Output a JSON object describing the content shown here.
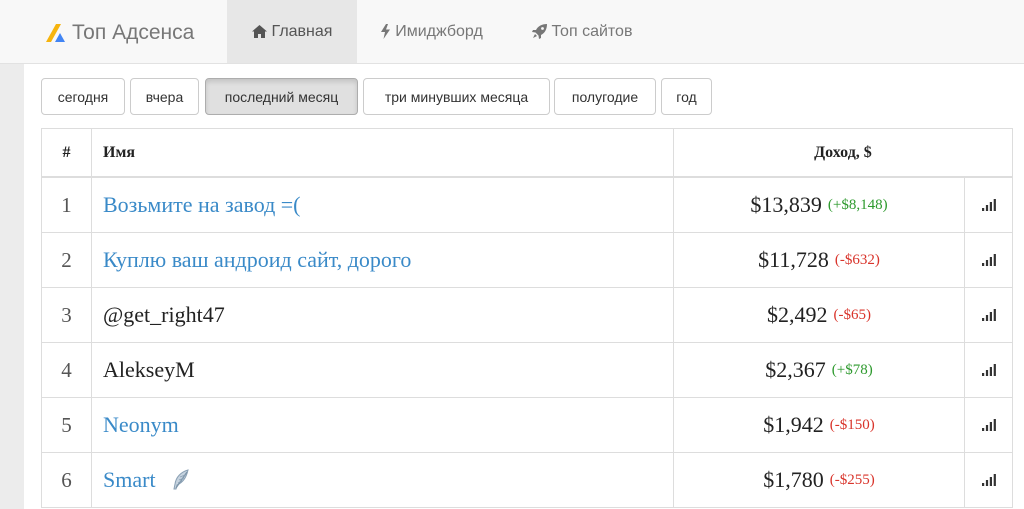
{
  "brand": {
    "name": "Топ Адсенса"
  },
  "nav": [
    {
      "label": "Главная",
      "icon": "home-icon",
      "active": true
    },
    {
      "label": "Имиджборд",
      "icon": "bolt-icon",
      "active": false
    },
    {
      "label": "Топ сайтов",
      "icon": "rocket-icon",
      "active": false
    }
  ],
  "periods": [
    {
      "label": "сегодня",
      "active": false
    },
    {
      "label": "вчера",
      "active": false
    },
    {
      "label": "последний месяц",
      "active": true
    },
    {
      "label": "три минувших месяца",
      "active": false
    },
    {
      "label": "полугодие",
      "active": false
    },
    {
      "label": "год",
      "active": false
    }
  ],
  "table": {
    "headers": {
      "num": "#",
      "name": "Имя",
      "income": "Доход, $"
    },
    "rows": [
      {
        "num": "1",
        "name": "Возьмите на завод =(",
        "link": true,
        "income": "$13,839",
        "delta": "(+$8,148)",
        "delta_sign": "pos"
      },
      {
        "num": "2",
        "name": "Куплю ваш андроид сайт, дорого",
        "link": true,
        "income": "$11,728",
        "delta": "(-$632)",
        "delta_sign": "neg"
      },
      {
        "num": "3",
        "name": "@get_right47",
        "link": false,
        "income": "$2,492",
        "delta": "(-$65)",
        "delta_sign": "neg"
      },
      {
        "num": "4",
        "name": "AlekseyM",
        "link": false,
        "income": "$2,367",
        "delta": "(+$78)",
        "delta_sign": "pos"
      },
      {
        "num": "5",
        "name": "Neonym",
        "link": true,
        "income": "$1,942",
        "delta": "(-$150)",
        "delta_sign": "neg"
      },
      {
        "num": "6",
        "name": "Smart",
        "link": true,
        "income": "$1,780",
        "delta": "(-$255)",
        "delta_sign": "neg",
        "badge": "feather-icon"
      }
    ]
  },
  "colors": {
    "link": "#3a8ac8",
    "positive": "#2e9a2e",
    "negative": "#d9342b",
    "logo_yellow": "#f6b40e",
    "logo_blue": "#4285f4"
  }
}
